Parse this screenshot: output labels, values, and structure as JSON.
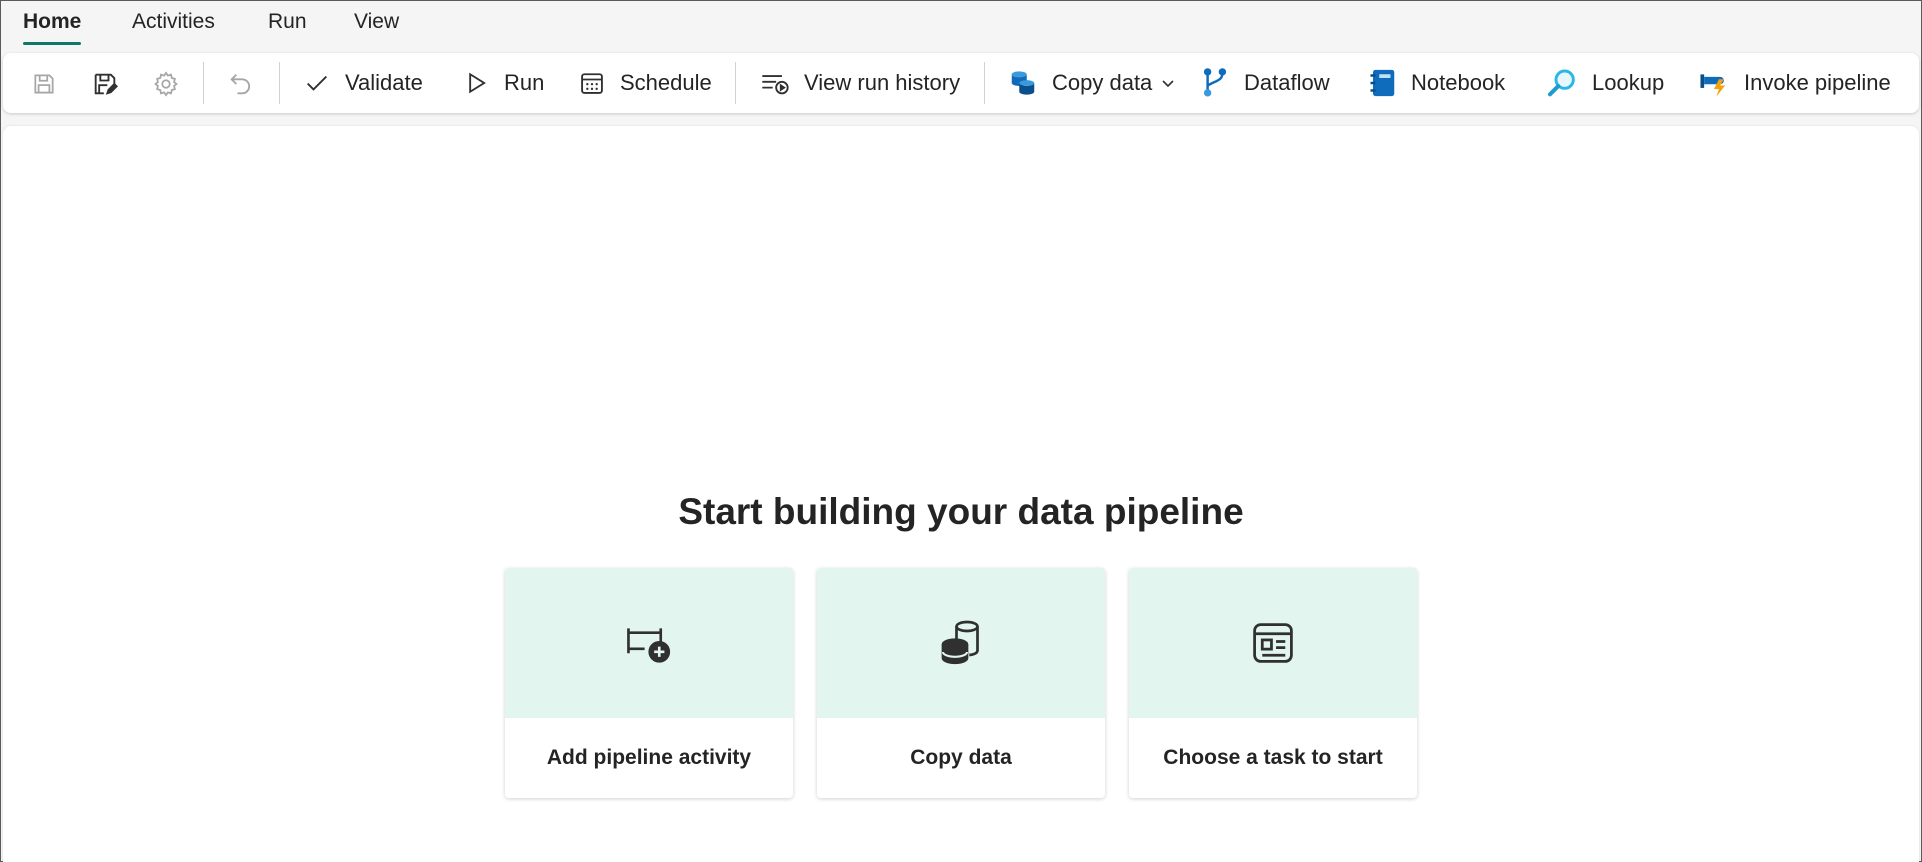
{
  "tabs": [
    {
      "label": "Home",
      "active": true
    },
    {
      "label": "Activities"
    },
    {
      "label": "Run"
    },
    {
      "label": "View"
    }
  ],
  "toolbar": {
    "save_icon": "save-icon",
    "save_as_icon": "save-edit-icon",
    "settings_icon": "gear-icon",
    "undo_icon": "undo-icon",
    "validate": "Validate",
    "run": "Run",
    "schedule": "Schedule",
    "view_run_history": "View run history",
    "copy_data": "Copy data",
    "dataflow": "Dataflow",
    "notebook": "Notebook",
    "lookup": "Lookup",
    "invoke_pipeline": "Invoke pipeline"
  },
  "canvas": {
    "headline": "Start building your data pipeline",
    "cards": [
      {
        "label": "Add pipeline activity",
        "icon": "pipeline-add-icon"
      },
      {
        "label": "Copy data",
        "icon": "database-copy-icon"
      },
      {
        "label": "Choose a task to start",
        "icon": "task-template-icon"
      }
    ]
  },
  "colors": {
    "accent": "#117865",
    "card_top": "#e2f5ee",
    "disabled_icon": "#a0a0a0",
    "brand_blue": "#0f6cbd"
  }
}
